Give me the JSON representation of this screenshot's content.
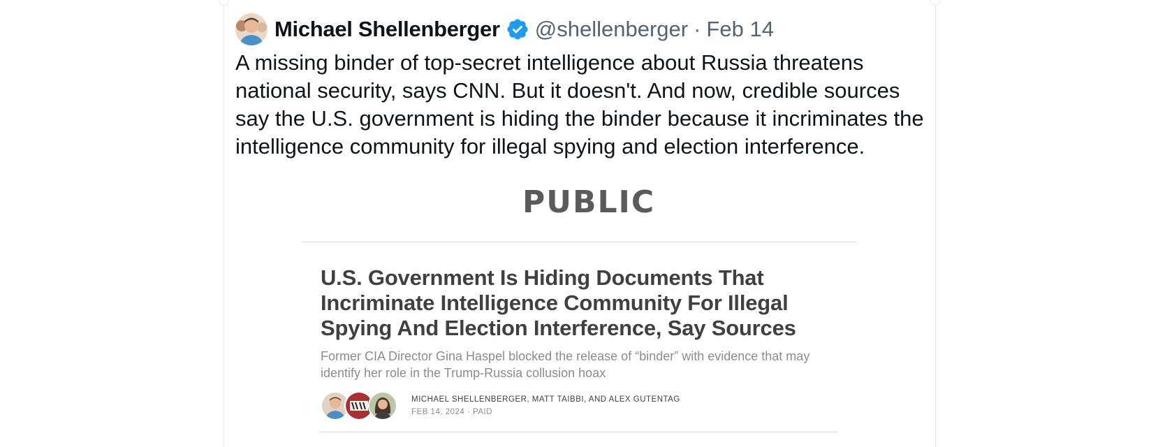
{
  "tweet": {
    "author_name": "Michael Shellenberger",
    "handle": "@shellenberger",
    "separator": "·",
    "date": "Feb 14",
    "verified": true,
    "text": "A missing binder of top-secret intelligence about Russia threatens\nnational security, says CNN. But it doesn't. And now, credible sources\nsay the U.S. government is hiding the binder because it incriminates the\nintelligence community for illegal spying and election interference."
  },
  "embed": {
    "publication": "PUBLIC",
    "title": "U.S. Government Is Hiding Documents That Incriminate Intelligence Community For Illegal Spying And Election Interference, Say Sources",
    "subtitle": "Former CIA Director Gina Haspel blocked the release of “binder” with evidence that may identify her role in the Trump-Russia collusion hoax",
    "authors": "MICHAEL SHELLENBERGER, MATT TAIBBI, AND ALEX GUTENTAG",
    "date_line": "FEB 14, 2024 · PAID"
  },
  "colors": {
    "text": "#0f1419",
    "secondary": "#536471",
    "verified": "#1d9bf0",
    "title": "#404040",
    "muted": "#8c8c8c"
  },
  "icons": {
    "verified": "verified-badge-icon"
  }
}
